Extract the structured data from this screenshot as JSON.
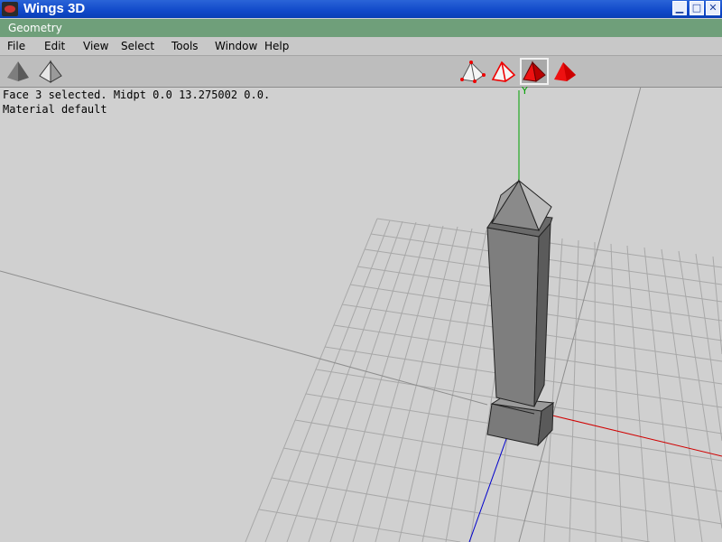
{
  "window": {
    "title": "Wings 3D",
    "minimize": "▁",
    "maximize": "□",
    "close": "✕"
  },
  "geometry_bar": {
    "label": "Geometry"
  },
  "menu": [
    "File",
    "Edit",
    "View",
    "Select",
    "Tools",
    "Window",
    "Help"
  ],
  "toolbar": {
    "view_modes": [
      "smooth-shaded-icon",
      "wireframe-icon"
    ],
    "selection_modes": [
      "vertex-select-icon",
      "edge-select-icon",
      "face-select-icon",
      "body-select-icon"
    ],
    "active_selection_mode": "face"
  },
  "status": {
    "line1": "Face 3 selected. Midpt 0.0 13.275002 0.0.",
    "line2": "Material default"
  },
  "viewport": {
    "axis_y_label": "Y"
  },
  "colors": {
    "face_selected": "#ee1111",
    "axis_x": "#d00000",
    "axis_y": "#00a000",
    "axis_z": "#0000cc",
    "grid": "#a8a8a8"
  }
}
